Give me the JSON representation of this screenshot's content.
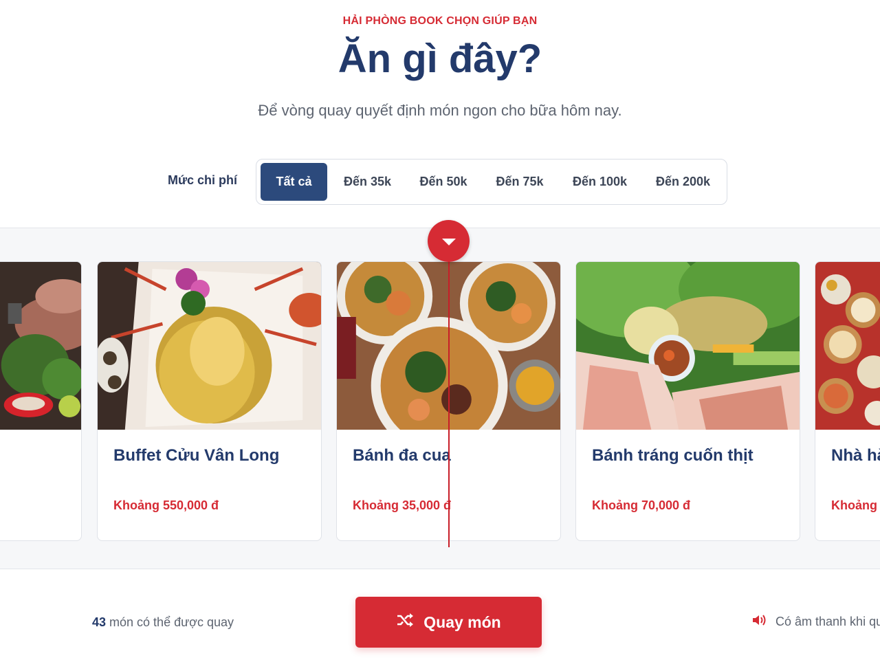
{
  "header": {
    "eyebrow": "HẢI PHÒNG BOOK CHỌN GIÚP BẠN",
    "title": "Ăn gì đây?",
    "subtitle": "Để vòng quay quyết định món ngon cho bữa hôm nay."
  },
  "filter": {
    "label": "Mức chi phí",
    "options": [
      "Tất cả",
      "Đến 35k",
      "Đến 50k",
      "Đến 75k",
      "Đến 100k",
      "Đến 200k"
    ],
    "selected": "Tất cả"
  },
  "cards": [
    {
      "name": "",
      "price": "",
      "image": "grilled-meat-platter"
    },
    {
      "name": "Buffet Cửu Vân Long",
      "price": "Khoảng 550,000 đ",
      "image": "golden-lobster"
    },
    {
      "name": "Bánh đa cua",
      "price": "Khoảng 35,000 đ",
      "image": "crab-noodle-soup"
    },
    {
      "name": "Bánh tráng cuốn thịt",
      "price": "Khoảng 70,000 đ",
      "image": "pork-rice-paper-rolls"
    },
    {
      "name": "Nhà hà",
      "price": "Khoảng",
      "image": "dim-sum-baskets"
    }
  ],
  "footer": {
    "count_number": "43",
    "count_text": " món có thể được quay",
    "spin_label": "Quay món",
    "sound_text": "Có âm thanh khi quay"
  },
  "colors": {
    "accent": "#d62b34",
    "primary": "#2c4a7c",
    "title": "#233a6b"
  },
  "icons": {
    "pointer": "caret-down-icon",
    "spin": "shuffle-icon",
    "sound": "speaker-icon"
  }
}
